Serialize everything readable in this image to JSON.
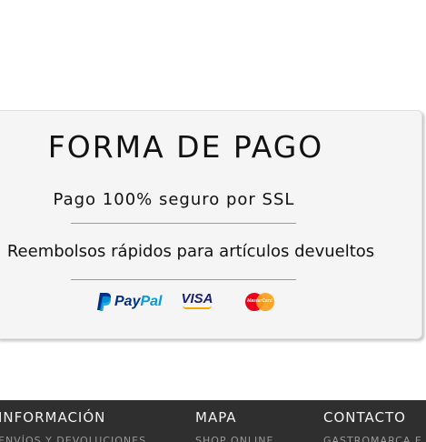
{
  "payment": {
    "title": "FORMA DE PAGO",
    "line1": "Pago 100% seguro por SSL",
    "line2": "Reembolsos rápidos para artículos devueltos",
    "logos": [
      {
        "name": "PayPal",
        "icon": "paypal-logo",
        "text_pay": "Pay",
        "text_pal": "Pal"
      },
      {
        "name": "VISA",
        "icon": "visa-logo",
        "text": "VISA"
      },
      {
        "name": "MasterCard",
        "icon": "mastercard-logo",
        "text": "MasterCard"
      }
    ]
  },
  "footer": {
    "background": "#2f2f2f",
    "columns": [
      {
        "heading": "INFORMACIÓN",
        "first_item": "ENVÍOS Y DEVOLUCIONES"
      },
      {
        "heading": "MAPA",
        "first_item": "SHOP ONLINE"
      },
      {
        "heading": "CONTACTO",
        "first_item": "GASTROMARCA E"
      }
    ]
  }
}
